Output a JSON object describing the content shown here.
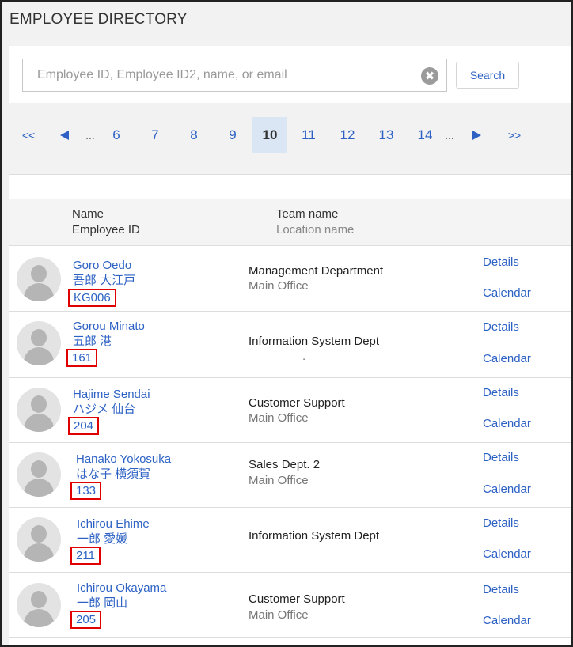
{
  "page": {
    "title": "EMPLOYEE DIRECTORY"
  },
  "search": {
    "placeholder": "Employee ID, Employee ID2, name, or email",
    "value": "",
    "clear_icon": "✖",
    "button_label": "Search"
  },
  "pagination": {
    "first": "<<",
    "dots_left": "...",
    "pages": [
      "6",
      "7",
      "8",
      "9",
      "10",
      "11",
      "12",
      "13",
      "14"
    ],
    "current": "10",
    "dots_right": "...",
    "last": ">>"
  },
  "table": {
    "headers": {
      "name": "Name",
      "employee_id": "Employee ID",
      "team": "Team name",
      "location": "Location name"
    },
    "actions": {
      "details": "Details",
      "calendar": "Calendar"
    },
    "rows": [
      {
        "name": "Goro Oedo",
        "name_jp": "吾郎 大江戸",
        "id": "KG006",
        "team": "Management Department",
        "location": "Main Office"
      },
      {
        "name": "Gorou Minato",
        "name_jp": "五郎 港",
        "id": "161",
        "team": "Information System Dept",
        "location": "."
      },
      {
        "name": "Hajime Sendai",
        "name_jp": "ハジメ 仙台",
        "id": "204",
        "team": "Customer Support",
        "location": "Main Office"
      },
      {
        "name": "Hanako Yokosuka",
        "name_jp": "はな子 横須賀",
        "id": "133",
        "team": "Sales Dept. 2",
        "location": "Main Office"
      },
      {
        "name": "Ichirou Ehime",
        "name_jp": "一郎 愛媛",
        "id": "211",
        "team": "Information System Dept",
        "location": ""
      },
      {
        "name": "Ichirou Okayama",
        "name_jp": "一郎 岡山",
        "id": "205",
        "team": "Customer Support",
        "location": "Main Office"
      }
    ]
  },
  "colors": {
    "link": "#2d62c4",
    "highlight_border": "#e00000",
    "current_page_bg": "#dbe6f5"
  }
}
